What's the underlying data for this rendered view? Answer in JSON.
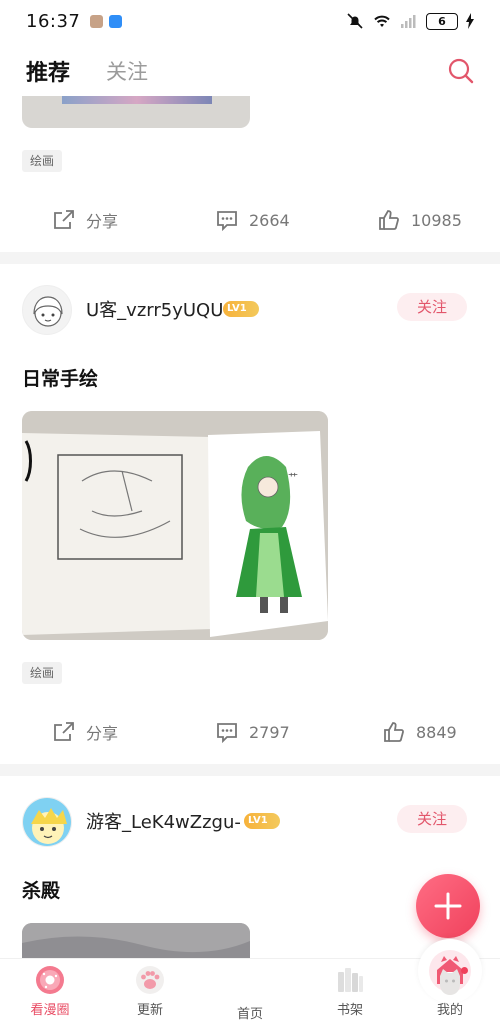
{
  "status_bar": {
    "time": "16:37",
    "battery": "6"
  },
  "top_tabs": {
    "active": "推荐",
    "inactive": "关注"
  },
  "posts": [
    {
      "tag": "绘画",
      "share_label": "分享",
      "comments": "2664",
      "likes": "10985"
    },
    {
      "username": "U客_vzrr5yUQU",
      "level": "LV1",
      "follow_label": "关注",
      "title": "日常手绘",
      "tag": "绘画",
      "share_label": "分享",
      "comments": "2797",
      "likes": "8849"
    },
    {
      "username": "游客_LeK4wZzgu-",
      "level": "LV1",
      "follow_label": "关注",
      "title": "杀殿"
    }
  ],
  "bottom_nav": {
    "items": [
      {
        "label": "看漫圈",
        "icon": "donut-icon"
      },
      {
        "label": "更新",
        "icon": "paw-icon"
      },
      {
        "label": "首页",
        "icon": "cat-house-icon"
      },
      {
        "label": "书架",
        "icon": "bookshelf-icon"
      },
      {
        "label": "我的",
        "icon": "profile-cat-icon"
      }
    ]
  },
  "colors": {
    "accent": "#e84a62",
    "follow_bg": "#fdeef0",
    "fab": "#f0415c"
  }
}
